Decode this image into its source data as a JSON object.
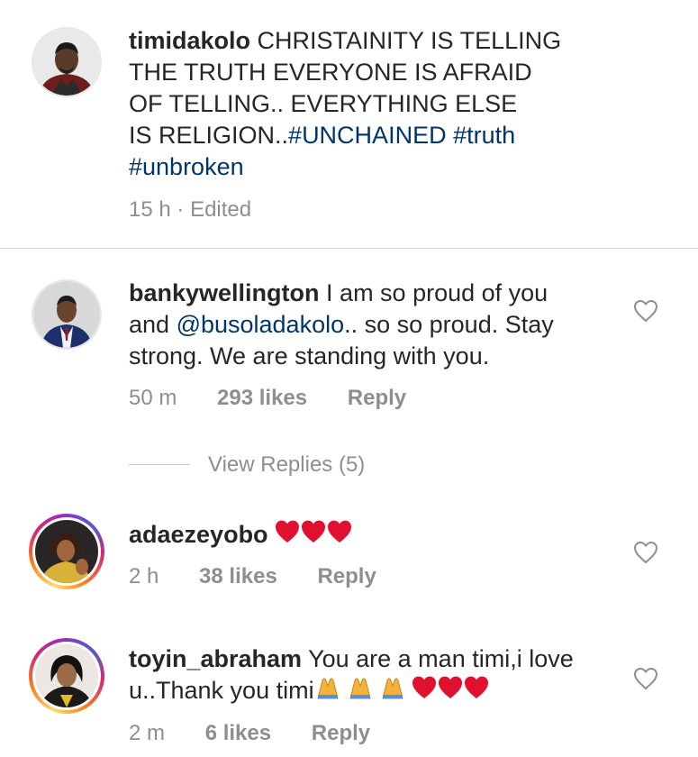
{
  "post": {
    "username": "timidakolo",
    "caption_lines": [
      "CHRISTAINITY IS TELLING",
      "THE TRUTH EVERYONE IS AFRAID",
      "OF TELLING.. EVERYTHING ELSE",
      "IS RELIGION.."
    ],
    "hashtag_1": "#UNCHAINED",
    "hashtag_2": "#truth",
    "hashtag_3": "#unbroken",
    "time": "15 h",
    "dot": "·",
    "edited": "Edited"
  },
  "comments": [
    {
      "username": "bankywellington",
      "text_1": "I am so proud of you",
      "text_2_pre": "and ",
      "mention": "@busoladakolo",
      "text_2_post": ".. so so proud. Stay",
      "text_3": "strong. We are standing with you.",
      "time": "50 m",
      "likes": "293 likes",
      "reply": "Reply",
      "view_replies": "View Replies (5)"
    },
    {
      "username": "adaezeyobo",
      "time": "2 h",
      "likes": "38 likes",
      "reply": "Reply"
    },
    {
      "username": "toyin_abraham",
      "text_1": "You are a man timi,i love",
      "text_2": "u..Thank you timi",
      "time": "2 m",
      "likes": "6 likes",
      "reply": "Reply"
    }
  ],
  "colors": {
    "hashtag": "#003569",
    "meta": "#8e8e8e",
    "heart": "#e0102e",
    "separator": "#dbdbdb"
  },
  "icons": [
    "heart-outline-icon",
    "red-heart-emoji",
    "folded-hands-emoji"
  ]
}
